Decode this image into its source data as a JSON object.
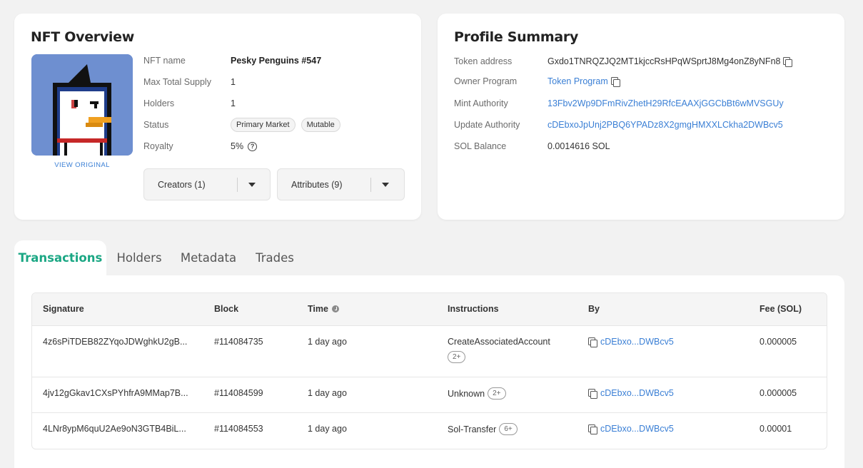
{
  "nft_overview": {
    "title": "NFT Overview",
    "view_original": "VIEW ORIGINAL",
    "fields": [
      {
        "label": "NFT name",
        "value": "Pesky Penguins #547"
      },
      {
        "label": "Max Total Supply",
        "value": "1"
      },
      {
        "label": "Holders",
        "value": "1"
      },
      {
        "label": "Status",
        "tags": [
          "Primary Market",
          "Mutable"
        ]
      },
      {
        "label": "Royalty",
        "value": "5%"
      }
    ],
    "creators_dropdown": "Creators (1)",
    "attributes_dropdown": "Attributes (9)"
  },
  "profile_summary": {
    "title": "Profile Summary",
    "fields": [
      {
        "label": "Token address",
        "value": "Gxdo1TNRQZJQ2MT1kjccRsHPqWSprtJ8Mg4onZ8yNFn8"
      },
      {
        "label": "Owner Program",
        "value": "Token Program"
      },
      {
        "label": "Mint Authority",
        "value": "13Fbv2Wp9DFmRivZhetH29RfcEAAXjGGCbBt6wMVSGUy"
      },
      {
        "label": "Update Authority",
        "value": "cDEbxoJpUnj2PBQ6YPADz8X2gmgHMXXLCkha2DWBcv5"
      },
      {
        "label": "SOL Balance",
        "value": "0.0014616 SOL"
      }
    ]
  },
  "tabs": [
    "Transactions",
    "Holders",
    "Metadata",
    "Trades"
  ],
  "transactions": {
    "headers": {
      "signature": "Signature",
      "block": "Block",
      "time": "Time",
      "instructions": "Instructions",
      "by": "By",
      "fee": "Fee (SOL)"
    },
    "rows": [
      {
        "signature": "4z6sPiTDEB82ZYqoJDWghkU2gB...",
        "block": "#114084735",
        "time": "1 day ago",
        "instruction": "CreateAssociatedAccount",
        "more": "2+",
        "by": "cDEbxo...DWBcv5",
        "fee": "0.000005"
      },
      {
        "signature": "4jv12gGkav1CXsPYhfrA9MMap7B...",
        "block": "#114084599",
        "time": "1 day ago",
        "instruction": "Unknown",
        "more": "2+",
        "by": "cDEbxo...DWBcv5",
        "fee": "0.000005"
      },
      {
        "signature": "4LNr8ypM6quU2Ae9oN3GTB4BiL...",
        "block": "#114084553",
        "time": "1 day ago",
        "instruction": "Sol-Transfer",
        "more": "6+",
        "by": "cDEbxo...DWBcv5",
        "fee": "0.00001"
      }
    ]
  },
  "colors": {
    "accent": "#1ba784",
    "link": "#3a7fd5",
    "nft_bg": "#6e8fd0"
  }
}
